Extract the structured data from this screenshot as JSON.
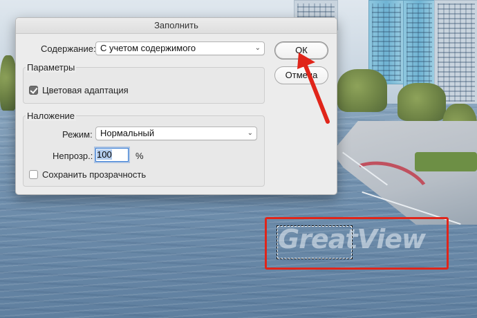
{
  "dialog": {
    "title": "Заполнить",
    "content_label": "Содержание:",
    "content_value": "С учетом содержимого",
    "params_group": {
      "title": "Параметры",
      "color_adapt_label": "Цветовая адаптация",
      "color_adapt_checked": true
    },
    "blend_group": {
      "title": "Наложение",
      "mode_label": "Режим:",
      "mode_value": "Нормальный",
      "opacity_label": "Непрозр.:",
      "opacity_value": "100",
      "opacity_unit": "%",
      "preserve_label": "Сохранить прозрачность",
      "preserve_checked": false
    },
    "ok_label": "ОК",
    "cancel_label": "Отмена"
  },
  "photo": {
    "watermark_text": "GreatView"
  },
  "colors": {
    "annotation_red": "#e0251a",
    "dialog_bg": "#ececec",
    "focus_blue": "#3b7fd6"
  },
  "icons": {
    "dropdown": "chevron-updown-icon",
    "check": "checkmark-icon",
    "annotation": "red-arrow-icon"
  }
}
